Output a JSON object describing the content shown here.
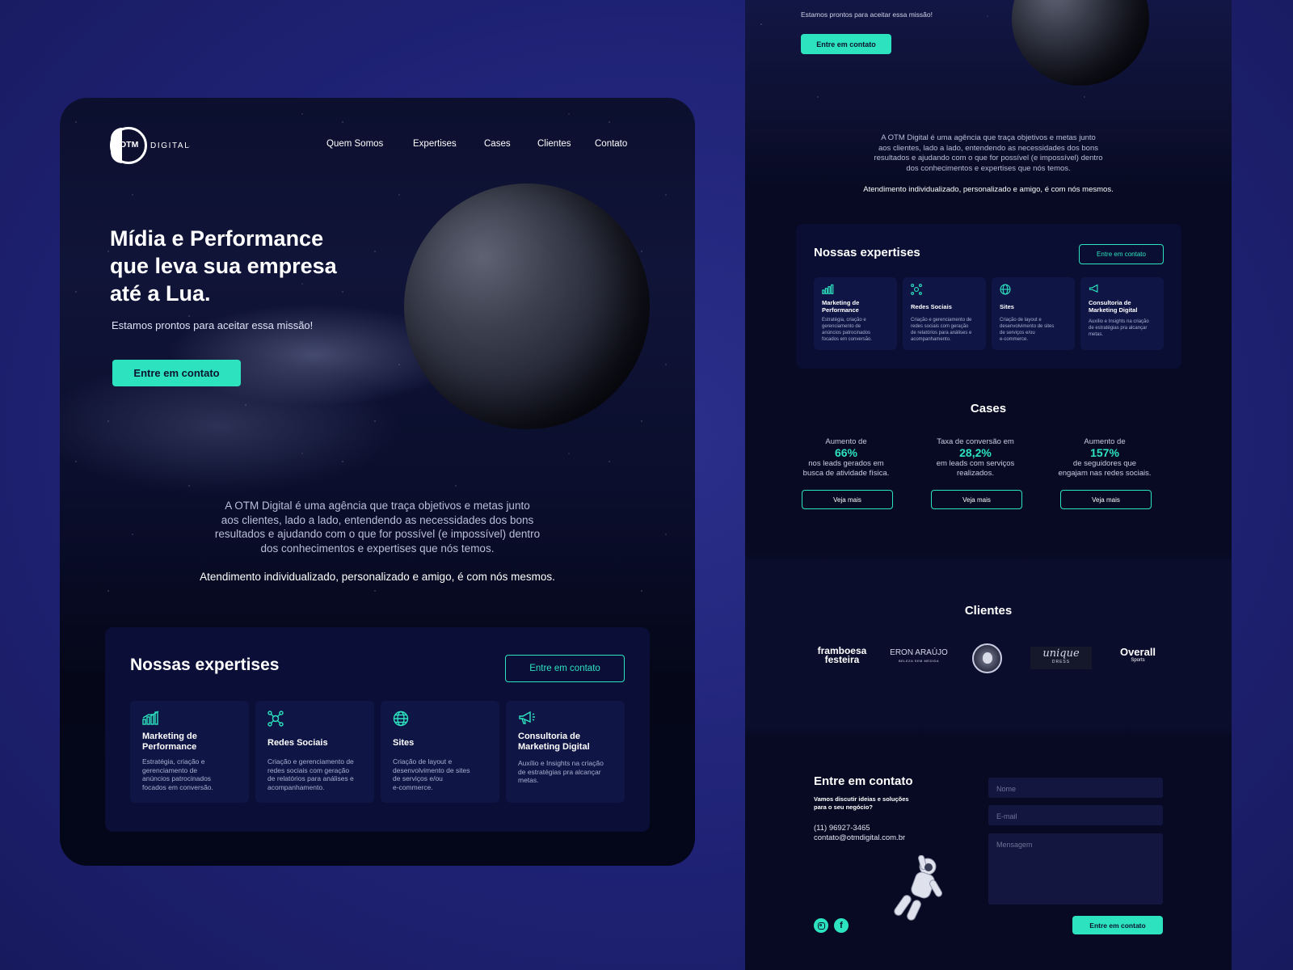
{
  "left": {
    "logo": {
      "mark": "OTM",
      "word": "DIGITAL"
    },
    "nav": [
      "Quem Somos",
      "Expertises",
      "Cases",
      "Clientes",
      "Contato"
    ],
    "hero": {
      "title_lines": [
        "Mídia e Performance",
        "que leva sua empresa",
        "até a Lua."
      ],
      "subtitle": "Estamos prontos para aceitar essa missão!",
      "cta": "Entre em contato"
    },
    "about": {
      "lines": [
        "A OTM Digital é uma agência que traça objetivos e metas junto",
        "aos clientes, lado a lado, entendendo as necessidades dos bons",
        "resultados e ajudando com o que for possível (e impossível) dentro",
        "dos conhecimentos e expertises que nós temos."
      ],
      "tagline": "Atendimento individualizado, personalizado e amigo, é com nós mesmos."
    },
    "expertises": {
      "heading": "Nossas expertises",
      "cta": "Entre em contato",
      "cards": [
        {
          "icon": "bar-chart-icon",
          "title_lines": [
            "Marketing de",
            "Performance"
          ],
          "desc_lines": [
            "Estratégia, criação e",
            "gerenciamento de",
            "anúncios patrocinados",
            "focados em conversão."
          ]
        },
        {
          "icon": "network-icon",
          "title_lines": [
            "Redes Sociais"
          ],
          "desc_lines": [
            "Criação e gerenciamento de",
            "redes sociais com geração",
            "de relatórios para análises e",
            "acompanhamento."
          ]
        },
        {
          "icon": "globe-icon",
          "title_lines": [
            "Sites"
          ],
          "desc_lines": [
            "Criação de layout e",
            "desenvolvimento de sites",
            "de serviços e/ou",
            "e-commerce."
          ]
        },
        {
          "icon": "megaphone-icon",
          "title_lines": [
            "Consultoria de",
            "Marketing Digital"
          ],
          "desc_lines": [
            "Auxílio e Insights na criação",
            "de estratégias pra alcançar",
            "metas."
          ]
        }
      ]
    }
  },
  "right": {
    "hero": {
      "subtitle": "Estamos prontos para aceitar essa missão!",
      "cta": "Entre em contato"
    },
    "about": {
      "lines": [
        "A OTM Digital é uma agência que traça objetivos e metas junto",
        "aos clientes, lado a lado, entendendo as necessidades dos bons",
        "resultados e ajudando com o que for possível (e impossível) dentro",
        "dos conhecimentos e expertises que nós temos."
      ],
      "tagline": "Atendimento individualizado, personalizado e amigo, é com nós mesmos."
    },
    "expertises": {
      "heading": "Nossas expertises",
      "cta": "Entre em contato",
      "cards": [
        {
          "title_lines": [
            "Marketing de",
            "Performance"
          ],
          "desc_lines": [
            "Estratégia, criação e",
            "gerenciamento de",
            "anúncios patrocinados",
            "focados em conversão."
          ]
        },
        {
          "title_lines": [
            "Redes Sociais"
          ],
          "desc_lines": [
            "Criação e gerenciamento de",
            "redes sociais com geração",
            "de relatórios para análises e",
            "acompanhamento."
          ]
        },
        {
          "title_lines": [
            "Sites"
          ],
          "desc_lines": [
            "Criação de layout e",
            "desenvolvimento de sites",
            "de serviços e/ou",
            "e-commerce."
          ]
        },
        {
          "title_lines": [
            "Consultoria de",
            "Marketing Digital"
          ],
          "desc_lines": [
            "Auxílio e Insights na criação",
            "de estratégias pra alcançar",
            "metas."
          ]
        }
      ]
    },
    "cases": {
      "heading": "Cases",
      "items": [
        {
          "top": "Aumento de",
          "value": "66%",
          "bottom_lines": [
            "nos leads gerados em",
            "busca de atividade física."
          ],
          "button": "Veja mais"
        },
        {
          "top": "Taxa de conversão em",
          "value": "28,2%",
          "bottom_lines": [
            "em leads com serviços",
            "realizados."
          ],
          "button": "Veja mais"
        },
        {
          "top": "Aumento de",
          "value": "157%",
          "bottom_lines": [
            "de seguidores que",
            "engajam nas redes sociais."
          ],
          "button": "Veja mais"
        }
      ]
    },
    "clients": {
      "heading": "Clientes",
      "logos": [
        {
          "line1": "framboesa",
          "line2": "festeira"
        },
        {
          "line1": "ERON ARAÚJO",
          "line2": "BELEZA SEM MEDIDA"
        },
        {
          "line1": "",
          "line2": ""
        },
        {
          "line1": "unique",
          "line2": "DRESS"
        },
        {
          "line1": "Overall",
          "line2": "Sports"
        }
      ]
    },
    "contact": {
      "heading": "Entre em contato",
      "sub_lines": [
        "Vamos discutir ideias e soluções",
        "para o seu negócio?"
      ],
      "phone": "(11) 96927-3465",
      "email": "contato@otmdigital.com.br",
      "placeholders": {
        "name": "Nome",
        "email": "E-mail",
        "message": "Mensagem"
      },
      "submit": "Entre em contato"
    }
  },
  "colors": {
    "accent": "#2de3bf",
    "background": "#1f2275",
    "panel": "#0f1545"
  }
}
